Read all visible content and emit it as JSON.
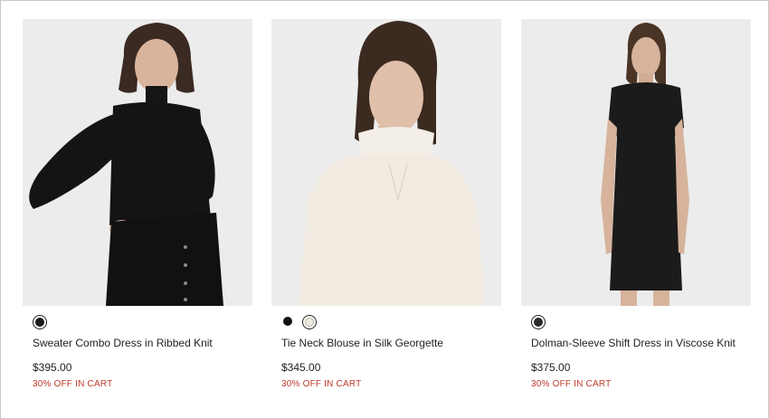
{
  "products": [
    {
      "name": "Sweater Combo Dress in Ribbed Knit",
      "price": "$395.00",
      "promo": "30% OFF IN CART",
      "swatches": [
        {
          "color": "#1a1a1a",
          "selected": true
        }
      ]
    },
    {
      "name": "Tie Neck Blouse in Silk Georgette",
      "price": "$345.00",
      "promo": "30% OFF IN CART",
      "swatches": [
        {
          "color": "#111111",
          "selected": false
        },
        {
          "color": "#efe9df",
          "selected": true
        }
      ]
    },
    {
      "name": "Dolman-Sleeve Shift Dress in Viscose Knit",
      "price": "$375.00",
      "promo": "30% OFF IN CART",
      "swatches": [
        {
          "color": "#2a2a2a",
          "selected": true
        }
      ]
    }
  ],
  "colors": {
    "promo": "#c0392b",
    "photo_background": "#ececec"
  }
}
